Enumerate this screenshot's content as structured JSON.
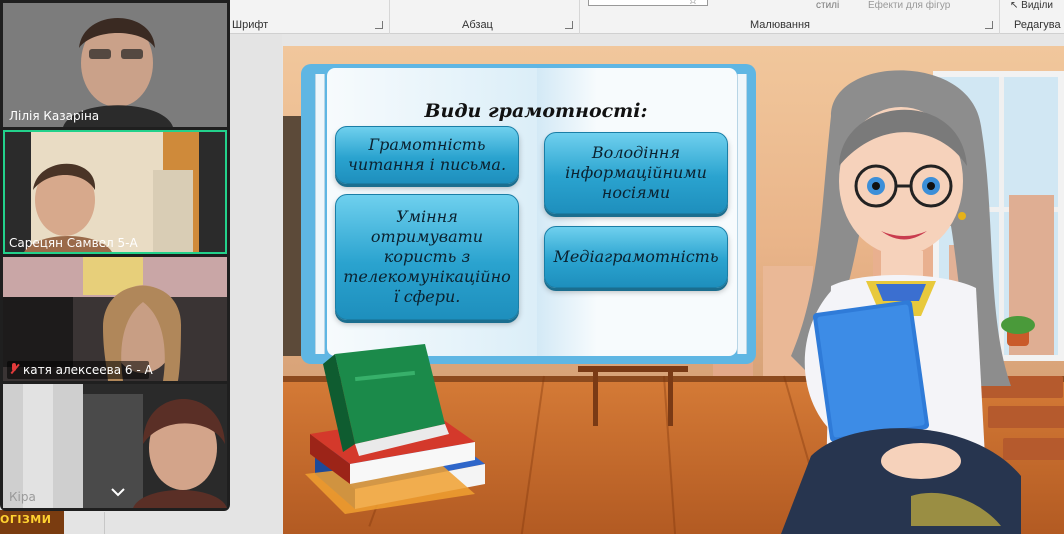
{
  "ribbon": {
    "font_group": "Шрифт",
    "paragraph_group": "Абзац",
    "drawing_group": "Малювання",
    "editing_group": "Редагува",
    "styles_label": "стилі",
    "effects_label": "Ефекти для фігур",
    "select_label": "Виділи"
  },
  "participants": [
    {
      "name": "Лілія Казаріна",
      "muted": false,
      "active": false
    },
    {
      "name": "Сарецян Самвел 5-А",
      "muted": false,
      "active": true
    },
    {
      "name": "катя алексеева 6 - А",
      "muted": true,
      "active": false
    },
    {
      "name": "Кіра",
      "muted": false,
      "active": false
    }
  ],
  "slide": {
    "title": "Види грамотності:",
    "cards": [
      "Грамотність читання і письма.",
      "Уміння отримувати користь з телекомунікаційно ї сфери.",
      "Володіння інформаційними носіями",
      "Медіаграмотність"
    ]
  },
  "thumbnail_text": "ОГІЗМИ",
  "colors": {
    "accent_active": "#23d18b",
    "card_blue": "#2aa3cf",
    "book_blue": "#5fb6e3",
    "mute_red": "#e23b3b"
  },
  "icons": [
    "mic-muted-icon",
    "chevron-down-icon",
    "dialog-launcher-icon"
  ]
}
